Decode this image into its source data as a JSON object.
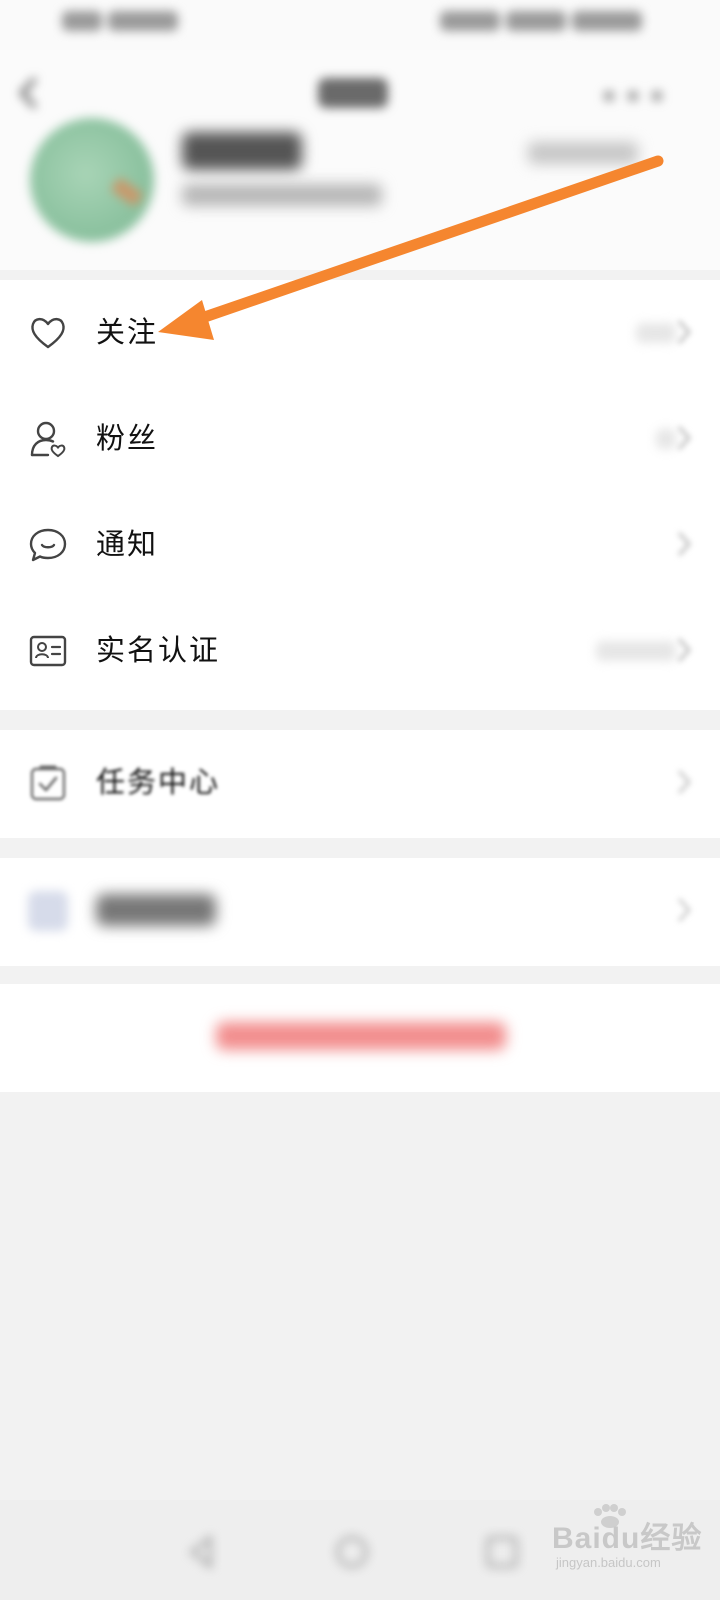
{
  "menu": {
    "items": [
      {
        "label": "关注",
        "icon": "heart-icon"
      },
      {
        "label": "粉丝",
        "icon": "fans-icon"
      },
      {
        "label": "通知",
        "icon": "chat-bubble-icon"
      },
      {
        "label": "实名认证",
        "icon": "id-card-icon"
      }
    ],
    "task_center": {
      "label": "任务中心",
      "icon": "task-check-icon"
    }
  },
  "watermark": {
    "main": "Baidu经验",
    "sub": "jingyan.baidu.com"
  },
  "colors": {
    "arrow": "#f5862f",
    "background": "#f2f2f2",
    "card": "#ffffff"
  }
}
